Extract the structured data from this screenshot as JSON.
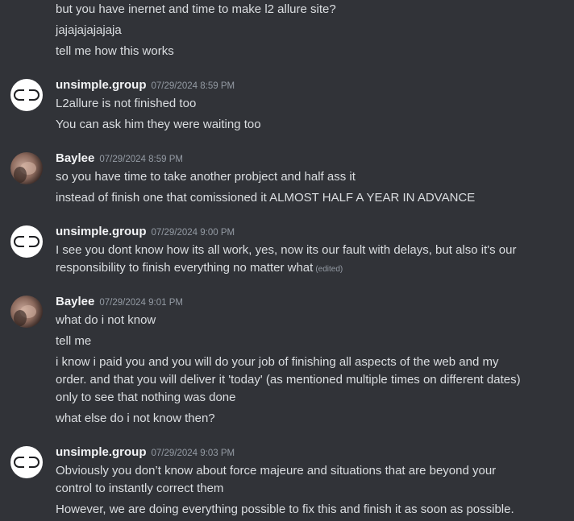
{
  "continuation": [
    "but you have inernet and time to make l2 allure site?",
    "jajajajajajaja",
    "tell me how this works"
  ],
  "messages": [
    {
      "author": "unsimple.group",
      "avatar_icon": "pill-logo-icon",
      "timestamp": "07/29/2024 8:59 PM",
      "lines": [
        "L2allure is not finished too",
        "You can ask him they were waiting too"
      ]
    },
    {
      "author": "Baylee",
      "avatar_icon": "user-photo",
      "timestamp": "07/29/2024 8:59 PM",
      "lines": [
        "so you have time to take another probject and half ass it",
        "instead of finish one that comissioned it ALMOST HALF A YEAR IN ADVANCE"
      ]
    },
    {
      "author": "unsimple.group",
      "avatar_icon": "pill-logo-icon",
      "timestamp": "07/29/2024 9:00 PM",
      "lines": [
        "I see you dont know how its all work, yes, now its our fault with delays, but also it's our responsibility to finish everything no matter what"
      ],
      "edited_label": "(edited)"
    },
    {
      "author": "Baylee",
      "avatar_icon": "user-photo",
      "timestamp": "07/29/2024 9:01 PM",
      "lines": [
        "what do i not know",
        "tell me",
        "i know i paid you and you will do your job of finishing all aspects of the web and my order. and that you will deliver it 'today' (as mentioned multiple times on different dates) only to see that nothing was done",
        "what else do i not know then?"
      ]
    },
    {
      "author": "unsimple.group",
      "avatar_icon": "pill-logo-icon",
      "timestamp": "07/29/2024 9:03 PM",
      "lines": [
        "Obviously you don’t know about force majeure and situations that are beyond your control to instantly correct them",
        "However, we are doing everything possible to fix this and finish it as soon as possible."
      ]
    }
  ],
  "colors": {
    "background": "#313338",
    "text": "#dbdee1",
    "username": "#f2f3f5",
    "timestamp": "#949ba4"
  }
}
